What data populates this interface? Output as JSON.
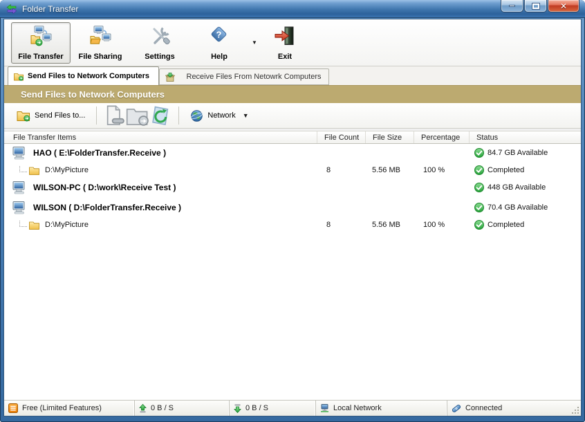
{
  "window": {
    "title": "Folder Transfer"
  },
  "icons": {
    "close": "✕",
    "dropdown": "▼"
  },
  "toolbar": {
    "buttons": [
      {
        "label": "File Transfer",
        "active": true
      },
      {
        "label": "File Sharing",
        "active": false
      },
      {
        "label": "Settings",
        "active": false
      },
      {
        "label": "Help",
        "active": false
      },
      {
        "label": "Exit",
        "active": false
      }
    ]
  },
  "tabs": [
    {
      "label": "Send Files to Network Computers",
      "active": true
    },
    {
      "label": "Receive Files From Netowrk Computers",
      "active": false
    }
  ],
  "section_header": "Send Files to Network Computers",
  "subtoolbar": {
    "send_label": "Send Files to...",
    "network_label": "Network"
  },
  "table": {
    "columns": [
      "File Transfer Items",
      "File Count",
      "File Size",
      "Percentage",
      "Status"
    ],
    "rows": [
      {
        "kind": "computer",
        "name": "HAO ( E:\\FolderTransfer.Receive )",
        "file_count": "",
        "file_size": "",
        "percentage": "",
        "status": "84.7 GB Available"
      },
      {
        "kind": "folder",
        "name": "D:\\MyPicture",
        "file_count": "8",
        "file_size": "5.56 MB",
        "percentage": "100 %",
        "status": "Completed"
      },
      {
        "kind": "computer",
        "name": "WILSON-PC ( D:\\work\\Receive Test )",
        "file_count": "",
        "file_size": "",
        "percentage": "",
        "status": "448 GB Available"
      },
      {
        "kind": "computer",
        "name": "WILSON ( D:\\FolderTransfer.Receive )",
        "file_count": "",
        "file_size": "",
        "percentage": "",
        "status": "70.4 GB Available"
      },
      {
        "kind": "folder",
        "name": "D:\\MyPicture",
        "file_count": "8",
        "file_size": "5.56 MB",
        "percentage": "100 %",
        "status": "Completed"
      }
    ]
  },
  "statusbar": {
    "license": "Free (Limited Features)",
    "upload_speed": "0 B / S",
    "download_speed": "0 B / S",
    "network": "Local Network",
    "connection": "Connected"
  },
  "colors": {
    "titlebar_blue": "#3f76ad",
    "gold_header": "#bcaa70",
    "status_green": "#22a036",
    "close_red": "#c03a22",
    "limited_orange": "#ec7c00"
  }
}
